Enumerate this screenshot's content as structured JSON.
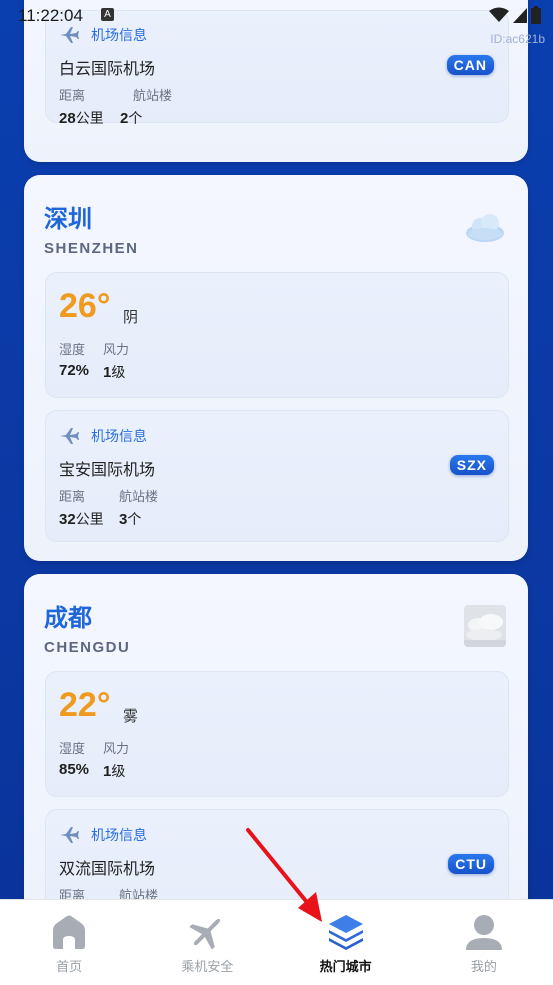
{
  "status": {
    "time": "11:22:04",
    "a_badge": "A",
    "device_id": "ID:ac621b"
  },
  "cards": [
    {
      "airport": {
        "header": "机场信息",
        "name": "白云国际机场",
        "code": "CAN",
        "distance_label": "距离",
        "terminal_label": "航站楼",
        "distance_value": "28",
        "distance_unit": "公里",
        "terminal_value": "2",
        "terminal_unit": "个"
      }
    },
    {
      "city": "深圳",
      "city_en": "SHENZHEN",
      "weather_icon": "cloud-icon",
      "temp": "26°",
      "weather": "阴",
      "humidity_label": "湿度",
      "wind_label": "风力",
      "humidity_value": "72%",
      "wind_value": "1",
      "wind_unit": "级",
      "airport": {
        "header": "机场信息",
        "name": "宝安国际机场",
        "code": "SZX",
        "distance_label": "距离",
        "terminal_label": "航站楼",
        "distance_value": "32",
        "distance_unit": "公里",
        "terminal_value": "3",
        "terminal_unit": "个"
      }
    },
    {
      "city": "成都",
      "city_en": "CHENGDU",
      "weather_icon": "fog-icon",
      "temp": "22°",
      "weather": "雾",
      "humidity_label": "湿度",
      "wind_label": "风力",
      "humidity_value": "85%",
      "wind_value": "1",
      "wind_unit": "级",
      "airport": {
        "header": "机场信息",
        "name": "双流国际机场",
        "code": "CTU",
        "distance_label": "距离",
        "terminal_label": "航站楼"
      }
    }
  ],
  "nav": [
    {
      "label": "首页",
      "icon": "home-icon",
      "active": false
    },
    {
      "label": "乘机安全",
      "icon": "airplane-icon",
      "active": false
    },
    {
      "label": "热门城市",
      "icon": "layers-icon",
      "active": true
    },
    {
      "label": "我的",
      "icon": "user-icon",
      "active": false
    }
  ],
  "colors": {
    "accent": "#1f66d9",
    "temp": "#f09a1e",
    "background": "#0a3fb0"
  }
}
